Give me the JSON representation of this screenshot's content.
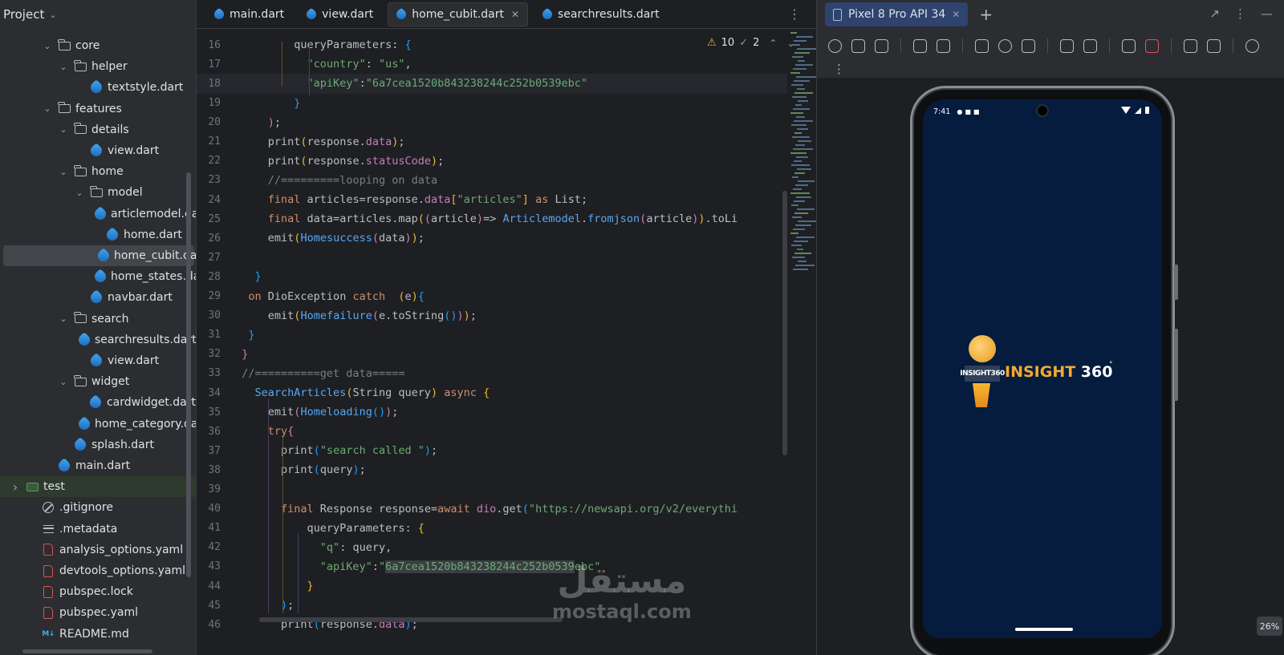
{
  "project_panel": {
    "title": "Project",
    "tree": [
      {
        "label": "core",
        "type": "folder",
        "depth": 2,
        "expanded": true
      },
      {
        "label": "helper",
        "type": "folder",
        "depth": 3,
        "expanded": true
      },
      {
        "label": "textstyle.dart",
        "type": "dart",
        "depth": 4
      },
      {
        "label": "features",
        "type": "folder",
        "depth": 2,
        "expanded": true
      },
      {
        "label": "details",
        "type": "folder",
        "depth": 3,
        "expanded": true
      },
      {
        "label": "view.dart",
        "type": "dart",
        "depth": 4
      },
      {
        "label": "home",
        "type": "folder",
        "depth": 3,
        "expanded": true
      },
      {
        "label": "model",
        "type": "folder",
        "depth": 4,
        "expanded": true
      },
      {
        "label": "articlemodel.da",
        "type": "dart",
        "depth": 5
      },
      {
        "label": "home.dart",
        "type": "dart",
        "depth": 5
      },
      {
        "label": "home_cubit.dar",
        "type": "dart",
        "depth": 5,
        "selected": true
      },
      {
        "label": "home_states.da",
        "type": "dart",
        "depth": 5
      },
      {
        "label": "navbar.dart",
        "type": "dart",
        "depth": 4
      },
      {
        "label": "search",
        "type": "folder",
        "depth": 3,
        "expanded": true
      },
      {
        "label": "searchresults.dart",
        "type": "dart",
        "depth": 4
      },
      {
        "label": "view.dart",
        "type": "dart",
        "depth": 4
      },
      {
        "label": "widget",
        "type": "folder",
        "depth": 3,
        "expanded": true
      },
      {
        "label": "cardwidget.dart",
        "type": "dart",
        "depth": 4
      },
      {
        "label": "home_category.da",
        "type": "dart",
        "depth": 4
      },
      {
        "label": "splash.dart",
        "type": "dart",
        "depth": 3
      },
      {
        "label": "main.dart",
        "type": "dart",
        "depth": 2
      },
      {
        "label": "test",
        "type": "test-folder",
        "depth": 0,
        "expanded": false
      },
      {
        "label": ".gitignore",
        "type": "git",
        "depth": 1
      },
      {
        "label": ".metadata",
        "type": "lines",
        "depth": 1
      },
      {
        "label": "analysis_options.yaml",
        "type": "yaml",
        "depth": 1
      },
      {
        "label": "devtools_options.yaml",
        "type": "yaml",
        "depth": 1
      },
      {
        "label": "pubspec.lock",
        "type": "yaml",
        "depth": 1
      },
      {
        "label": "pubspec.yaml",
        "type": "yaml",
        "depth": 1
      },
      {
        "label": "README.md",
        "type": "md",
        "depth": 1
      }
    ]
  },
  "editor": {
    "tabs": [
      {
        "label": "main.dart",
        "active": false
      },
      {
        "label": "view.dart",
        "active": false
      },
      {
        "label": "home_cubit.dart",
        "active": true
      },
      {
        "label": "searchresults.dart",
        "active": false
      }
    ],
    "inspections": {
      "warnings": "10",
      "checks": "2"
    },
    "current_line": 18,
    "lines": [
      {
        "n": "16",
        "html": "          <span>queryParameters: </span><span class=\"b3\">{</span>"
      },
      {
        "n": "17",
        "html": "            <span class=\"s\">\"country\"</span><span>: </span><span class=\"s\">\"us\"</span><span>,</span>"
      },
      {
        "n": "18",
        "html": "            <span class=\"s\">\"apiKey\"</span><span>:</span><span class=\"s\">\"6a7cea1520b843238244c252b0539ebc\"</span>"
      },
      {
        "n": "19",
        "html": "          <span class=\"b3\">}</span>"
      },
      {
        "n": "20",
        "html": "      <span class=\"b2\">)</span><span>;</span>"
      },
      {
        "n": "21",
        "html": "      <span>print</span><span class=\"b1\">(</span><span>response.</span><span class=\"p\">data</span><span class=\"b1\">)</span><span>;</span>"
      },
      {
        "n": "22",
        "html": "      <span>print</span><span class=\"b1\">(</span><span>response.</span><span class=\"p\">statusCode</span><span class=\"b1\">)</span><span>;</span>"
      },
      {
        "n": "23",
        "html": "      <span class=\"c\">//=========looping on data</span>"
      },
      {
        "n": "24",
        "html": "      <span class=\"k\">final</span><span> articles=response.</span><span class=\"p\">data</span><span class=\"b1\">[</span><span class=\"s\">\"articles\"</span><span class=\"b1\">]</span><span> </span><span class=\"k\">as</span><span> List;</span>"
      },
      {
        "n": "25",
        "html": "      <span class=\"k\">final</span><span> data=articles.map</span><span class=\"b1\">(</span><span class=\"b2\">(</span><span>article</span><span class=\"b2\">)</span><span>=&gt; </span><span class=\"f\">Articlemodel</span><span>.</span><span class=\"f\">fromjson</span><span class=\"b2\">(</span><span>article</span><span class=\"b2\">)</span><span class=\"b1\">)</span><span>.toLi</span>"
      },
      {
        "n": "26",
        "html": "      <span>emit</span><span class=\"b1\">(</span><span class=\"f\">Homesuccess</span><span class=\"b2\">(</span><span>data</span><span class=\"b2\">)</span><span class=\"b1\">)</span><span>;</span>"
      },
      {
        "n": "27",
        "html": ""
      },
      {
        "n": "28",
        "html": "    <span class=\"b3\">}</span>"
      },
      {
        "n": "29",
        "html": "   <span class=\"k\">on</span><span> DioException </span><span class=\"k\">catch</span><span>  </span><span class=\"b1\">(</span><span>e</span><span class=\"b1\">)</span><span class=\"b3\">{</span>"
      },
      {
        "n": "30",
        "html": "      <span>emit</span><span class=\"b1\">(</span><span class=\"f\">Homefailure</span><span class=\"b2\">(</span><span>e.toString</span><span class=\"b3\">()</span><span class=\"b2\">)</span><span class=\"b1\">)</span><span>;</span>"
      },
      {
        "n": "31",
        "html": "   <span class=\"b3\">}</span>"
      },
      {
        "n": "32",
        "html": "  <span class=\"b2\">}</span>"
      },
      {
        "n": "33",
        "html": "  <span class=\"c\">//==========get data=====</span>"
      },
      {
        "n": "34",
        "html": "    <span class=\"f\">SearchArticles</span><span class=\"b1\">(</span><span>String query</span><span class=\"b1\">)</span><span> </span><span class=\"k\">async</span><span> </span><span class=\"b1\">{</span>"
      },
      {
        "n": "35",
        "html": "      <span>emit</span><span class=\"b2\">(</span><span class=\"f\">Homeloading</span><span class=\"b3\">()</span><span class=\"b2\">)</span><span>;</span>"
      },
      {
        "n": "36",
        "html": "      <span class=\"k\">try</span><span class=\"b2\">{</span>"
      },
      {
        "n": "37",
        "html": "        <span>print</span><span class=\"b3\">(</span><span class=\"s\">\"search called \"</span><span class=\"b3\">)</span><span>;</span>"
      },
      {
        "n": "38",
        "html": "        <span>print</span><span class=\"b3\">(</span><span>query</span><span class=\"b3\">)</span><span>;</span>"
      },
      {
        "n": "39",
        "html": ""
      },
      {
        "n": "40",
        "html": "        <span class=\"k\">final</span><span> Response response=</span><span class=\"k\">await</span><span> </span><span class=\"p\">dio</span><span>.get</span><span class=\"b3\">(</span><span class=\"s\">\"https://newsapi.org/v2/everythi</span>"
      },
      {
        "n": "41",
        "html": "            <span>queryParameters: </span><span class=\"b1\">{</span>"
      },
      {
        "n": "42",
        "html": "              <span class=\"s\">\"q\"</span><span>: query,</span>"
      },
      {
        "n": "43",
        "html": "              <span class=\"s\">\"apiKey\"</span><span>:</span><span class=\"s\">\"</span><span class=\"s sel\">6a7cea1520b843238244c252b0539</span><span class=\"s\">ebc\"</span>"
      },
      {
        "n": "44",
        "html": "            <span class=\"b1\">}</span>"
      },
      {
        "n": "45",
        "html": "        <span class=\"b3\">)</span><span>;</span>"
      },
      {
        "n": "46",
        "html": "        <span>print</span><span class=\"b3\">(</span><span>response.</span><span class=\"p\">data</span><span class=\"b3\">)</span><span>;</span>"
      }
    ]
  },
  "watermark": {
    "arabic": "مستقل",
    "url": "mostaql.com"
  },
  "emulator": {
    "device_tab": "Pixel 8 Pro API 34",
    "status_time": "7:41",
    "app_logo_tag": "INSIGHT360",
    "app_logo_text_1": "INSIGHT",
    "app_logo_text_2": " 360",
    "app_logo_degree": "°",
    "zoom": "26%"
  }
}
